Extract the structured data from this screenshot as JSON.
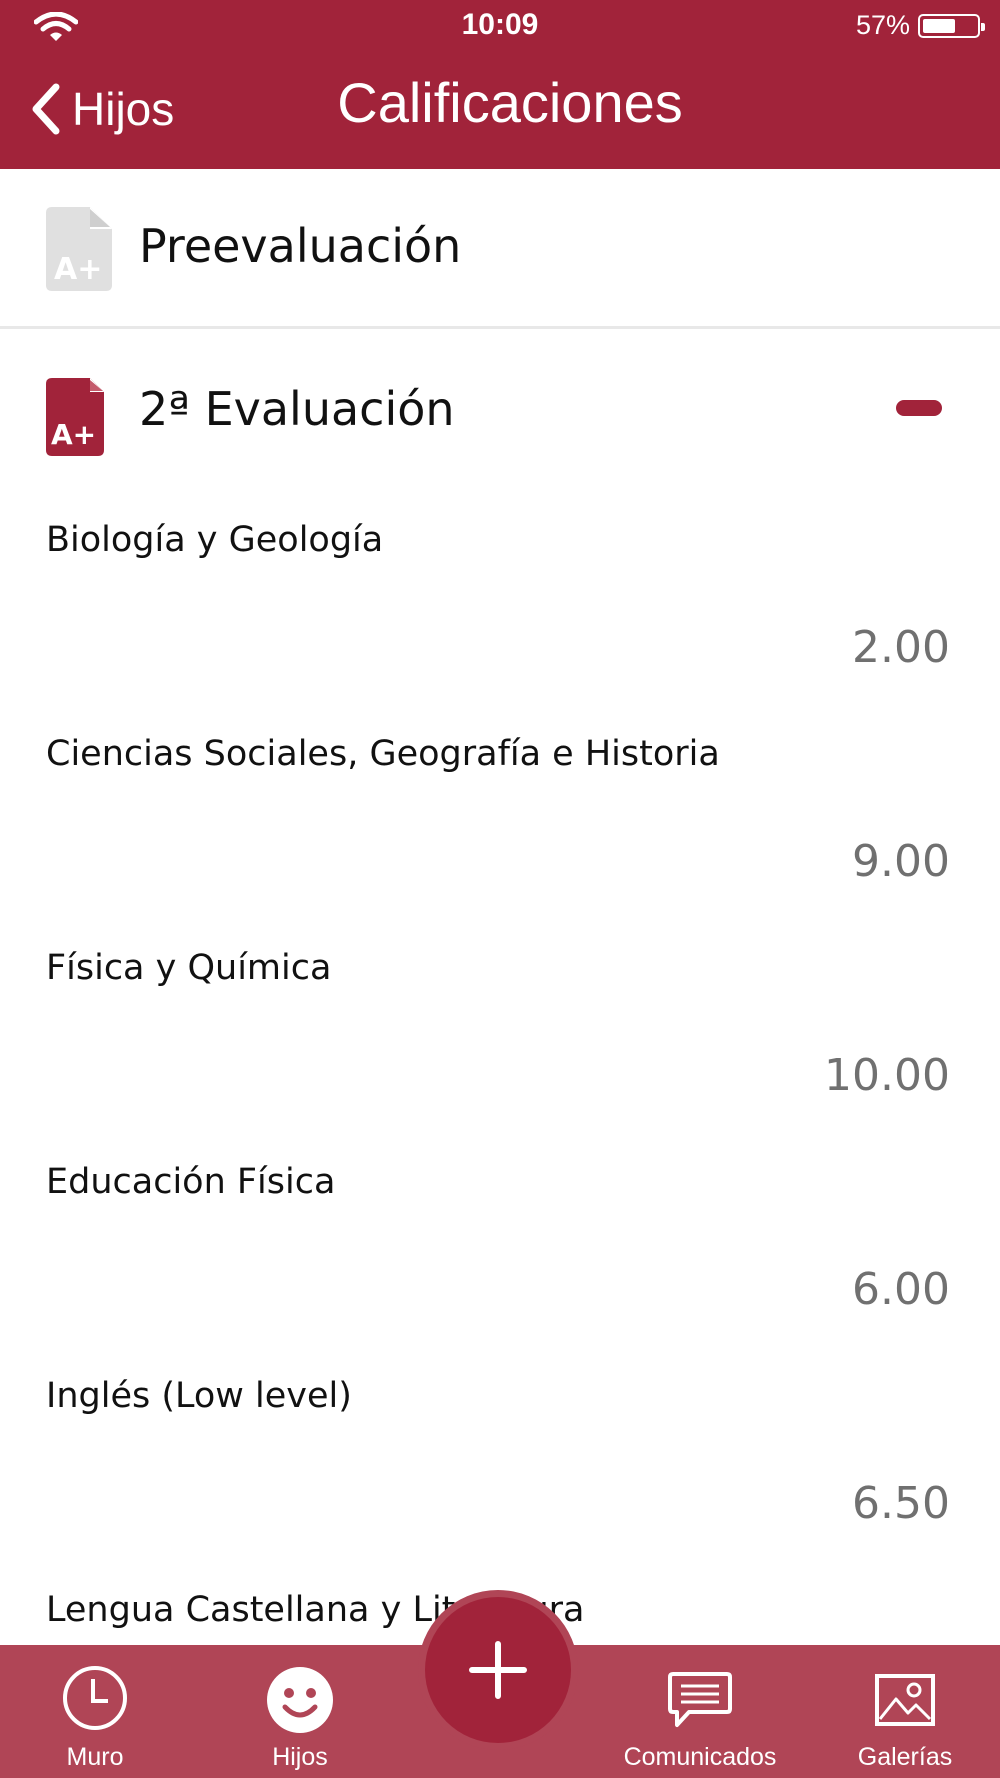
{
  "status_bar": {
    "time": "10:09",
    "battery": "57%"
  },
  "header": {
    "back_label": "Hijos",
    "title": "Calificaciones"
  },
  "sections": [
    {
      "label": "Preevaluación",
      "expanded": false
    },
    {
      "label": "2ª Evaluación",
      "expanded": true
    }
  ],
  "grades": [
    {
      "subject": "Biología y Geología",
      "score": "2.00"
    },
    {
      "subject": "Ciencias Sociales, Geografía e Historia",
      "score": "9.00"
    },
    {
      "subject": "Física y Química",
      "score": "10.00"
    },
    {
      "subject": "Educación Física",
      "score": "6.00"
    },
    {
      "subject": "Inglés (Low level)",
      "score": "6.50"
    },
    {
      "subject": "Lengua Castellana y Literatura",
      "score": ""
    }
  ],
  "doc_icon_text": "A+",
  "bottom_nav": {
    "muro": "Muro",
    "hijos": "Hijos",
    "comunicados": "Comunicados",
    "galerias": "Galerías"
  },
  "colors": {
    "brand": "#a1233a",
    "nav_bg": "#b04556",
    "muted_icon": "#e0e0e0",
    "score_text": "#707070"
  },
  "icons": [
    "wifi-icon",
    "battery-icon",
    "chevron-left-icon",
    "document-grade-icon",
    "minus-icon",
    "clock-icon",
    "smiley-icon",
    "plus-icon",
    "chat-icon",
    "image-icon"
  ]
}
